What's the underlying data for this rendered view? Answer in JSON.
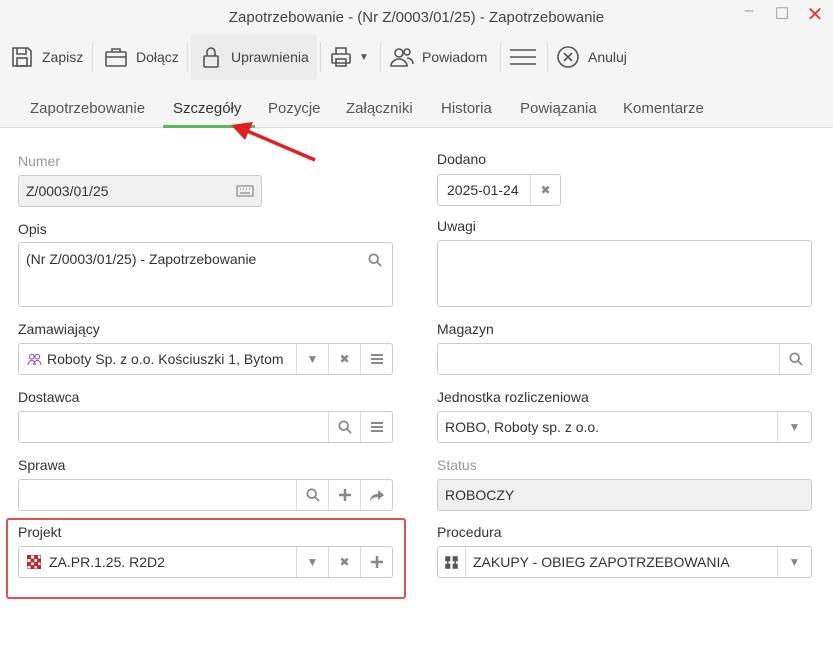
{
  "window": {
    "title": "Zapotrzebowanie - (Nr Z/0003/01/25) - Zapotrzebowanie"
  },
  "toolbar": {
    "save": "Zapisz",
    "attach": "Dołącz",
    "permissions": "Uprawnienia",
    "notify": "Powiadom",
    "cancel": "Anuluj"
  },
  "tabs": [
    "Zapotrzebowanie",
    "Szczegóły",
    "Pozycje",
    "Załączniki",
    "Historia",
    "Powiązania",
    "Komentarze"
  ],
  "active_tab": "Szczegóły",
  "form": {
    "numer": {
      "label": "Numer",
      "value": "Z/0003/01/25"
    },
    "opis": {
      "label": "Opis",
      "value": "(Nr Z/0003/01/25) - Zapotrzebowanie"
    },
    "zamawiajacy": {
      "label": "Zamawiający",
      "value": "Roboty Sp. z o.o. Kościuszki 1, Bytom"
    },
    "dostawca": {
      "label": "Dostawca",
      "value": ""
    },
    "sprawa": {
      "label": "Sprawa",
      "value": ""
    },
    "projekt": {
      "label": "Projekt",
      "value": "ZA.PR.1.25. R2D2"
    },
    "dodano": {
      "label": "Dodano",
      "value": "2025-01-24"
    },
    "uwagi": {
      "label": "Uwagi",
      "value": ""
    },
    "magazyn": {
      "label": "Magazyn",
      "value": ""
    },
    "jednostka": {
      "label": "Jednostka rozliczeniowa",
      "value": "ROBO, Roboty sp. z o.o."
    },
    "status": {
      "label": "Status",
      "value": "ROBOCZY"
    },
    "procedura": {
      "label": "Procedura",
      "value": "ZAKUPY - OBIEG ZAPOTRZEBOWANIA"
    }
  },
  "colors": {
    "accent": "#5cb85c",
    "annotation": "#e05252",
    "close": "#e53935"
  }
}
